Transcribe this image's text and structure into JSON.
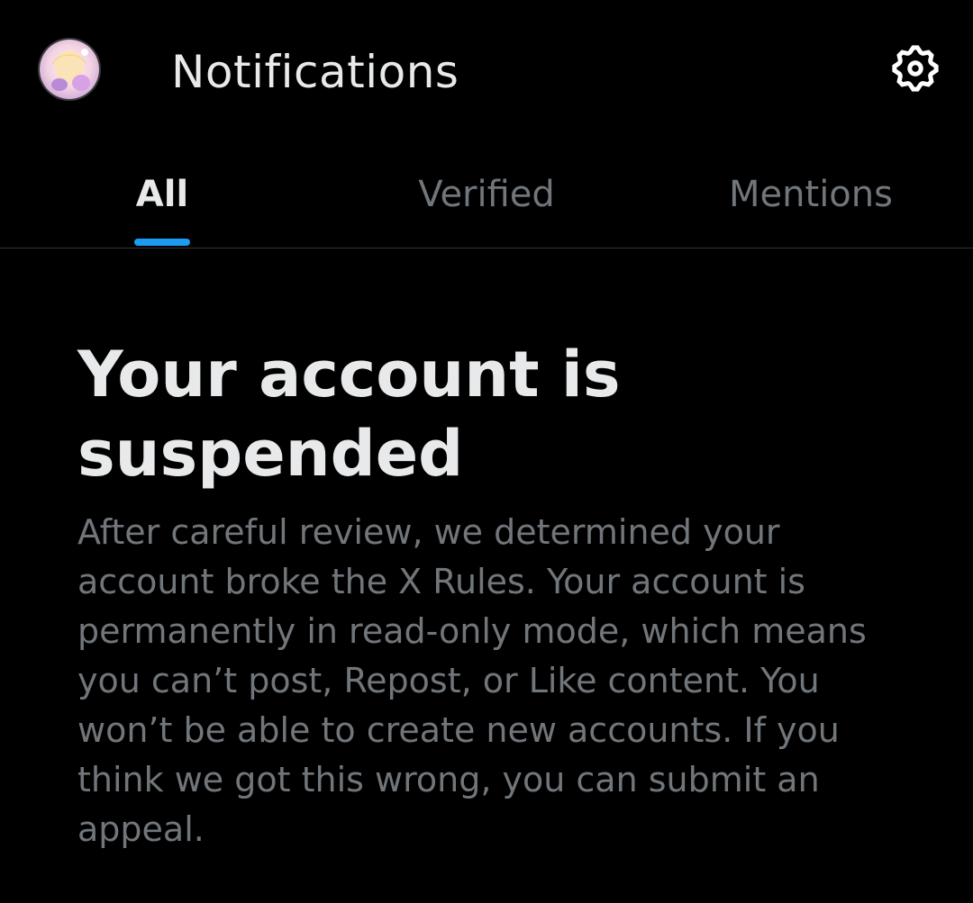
{
  "header": {
    "title": "Notifications",
    "avatar_icon": "profile-avatar",
    "settings_icon": "gear-icon"
  },
  "tabs": [
    {
      "label": "All",
      "active": true
    },
    {
      "label": "Verified",
      "active": false
    },
    {
      "label": "Mentions",
      "active": false
    }
  ],
  "notice": {
    "title": "Your account is suspended",
    "body": "After careful review, we determined your account broke the X Rules. Your account is permanently in read-only mode, which means you can’t post, Repost, or Like content. You won’t be able to create new accounts. If you think we got this wrong, you can submit an appeal."
  },
  "colors": {
    "background": "#000000",
    "primary_text": "#e7e9ea",
    "secondary_text": "#71767b",
    "accent": "#1d9bf0",
    "divider": "#2f3336"
  }
}
